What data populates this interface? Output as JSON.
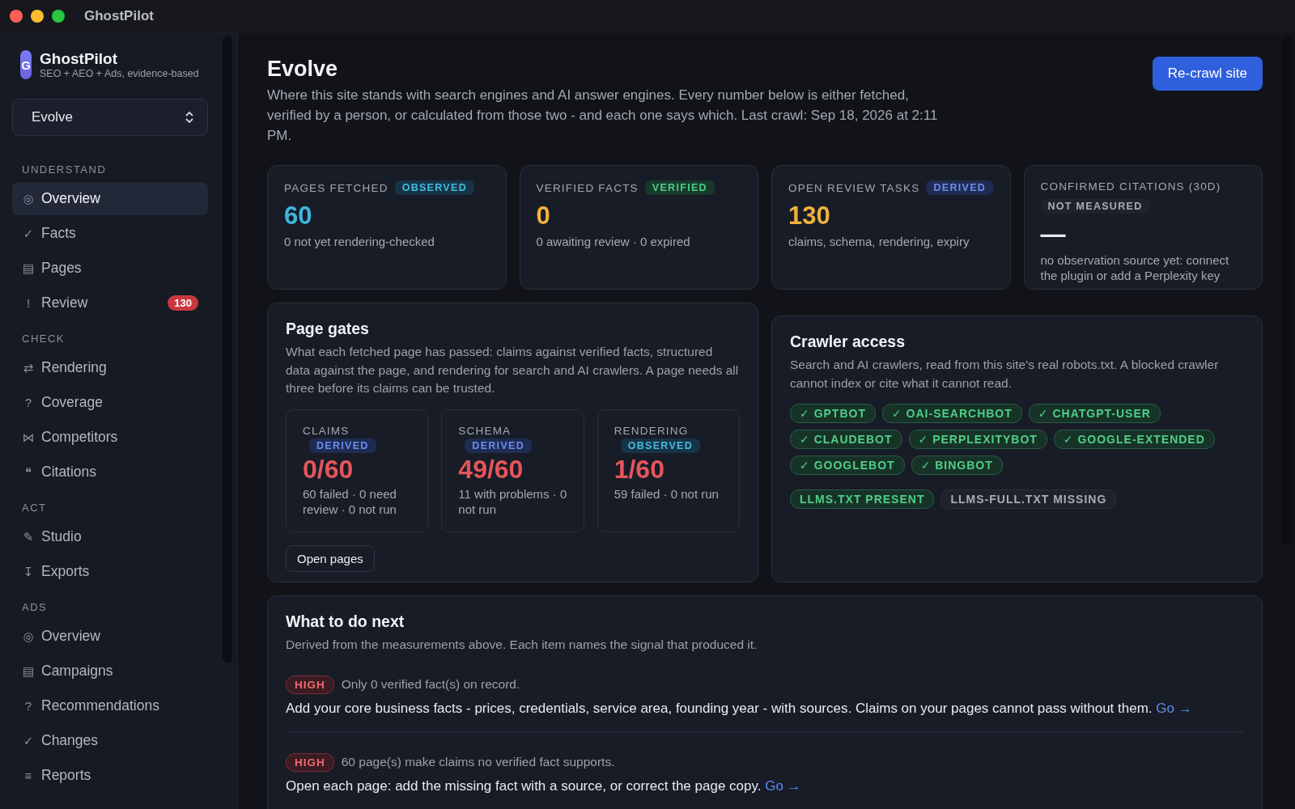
{
  "window": {
    "title": "GhostPilot"
  },
  "sidebar": {
    "brand": {
      "letter": "G",
      "name": "GhostPilot",
      "tagline": "SEO + AEO + Ads, evidence-based"
    },
    "site_select": {
      "value": "Evolve"
    },
    "sections": [
      {
        "heading": "UNDERSTAND",
        "items": [
          {
            "icon": "◎",
            "label": "Overview",
            "selected": true
          },
          {
            "icon": "✓",
            "label": "Facts",
            "selected": false
          },
          {
            "icon": "▤",
            "label": "Pages",
            "selected": false
          },
          {
            "icon": "!",
            "label": "Review",
            "selected": false,
            "count": "130"
          }
        ]
      },
      {
        "heading": "CHECK",
        "items": [
          {
            "icon": "⇄",
            "label": "Rendering",
            "selected": false
          },
          {
            "icon": "?",
            "label": "Coverage",
            "selected": false
          },
          {
            "icon": "⋈",
            "label": "Competitors",
            "selected": false
          },
          {
            "icon": "❝",
            "label": "Citations",
            "selected": false
          }
        ]
      },
      {
        "heading": "ACT",
        "items": [
          {
            "icon": "✎",
            "label": "Studio",
            "selected": false
          },
          {
            "icon": "↧",
            "label": "Exports",
            "selected": false
          }
        ]
      },
      {
        "heading": "ADS",
        "items": [
          {
            "icon": "◎",
            "label": "Overview",
            "selected": false
          },
          {
            "icon": "▤",
            "label": "Campaigns",
            "selected": false
          },
          {
            "icon": "?",
            "label": "Recommendations",
            "selected": false
          },
          {
            "icon": "✓",
            "label": "Changes",
            "selected": false
          },
          {
            "icon": "≡",
            "label": "Reports",
            "selected": false
          }
        ]
      }
    ]
  },
  "header": {
    "title": "Evolve",
    "description": "Where this site stands with search engines and AI answer engines. Every number below is either fetched, verified by a person, or calculated from those two - and each one says which. Last crawl: Sep 18, 2026 at 2:11 PM.",
    "button": "Re-crawl site"
  },
  "stats": [
    {
      "label": "PAGES FETCHED",
      "tag": {
        "kind": "observed",
        "text": "OBSERVED"
      },
      "value": "60",
      "color": "#3fb6dc",
      "note": "0 not yet rendering-checked"
    },
    {
      "label": "VERIFIED FACTS",
      "tag": {
        "kind": "verified",
        "text": "VERIFIED"
      },
      "value": "0",
      "color": "#f0b13c",
      "note": "0 awaiting review · 0 expired"
    },
    {
      "label": "OPEN REVIEW TASKS",
      "tag": {
        "kind": "derived",
        "text": "DERIVED"
      },
      "value": "130",
      "color": "#f0b13c",
      "note": "claims, schema, rendering, expiry"
    },
    {
      "label": "CONFIRMED CITATIONS (30D)",
      "tag": {
        "kind": "not_measured",
        "text": "NOT MEASURED"
      },
      "value": "—",
      "color": "#e8eaf0",
      "note": "no observation source yet: connect the plugin or add a Perplexity key"
    }
  ],
  "page_gates": {
    "title": "Page gates",
    "description": "What each fetched page has passed: claims against verified facts, structured data against the page, and rendering for search and AI crawlers. A page needs all three before its claims can be trusted.",
    "gates": [
      {
        "label": "CLAIMS",
        "tag": {
          "kind": "derived",
          "text": "DERIVED"
        },
        "value": "0/60",
        "note": "60 failed · 0 need review · 0 not run"
      },
      {
        "label": "SCHEMA",
        "tag": {
          "kind": "derived",
          "text": "DERIVED"
        },
        "value": "49/60",
        "note": "11 with problems · 0 not run"
      },
      {
        "label": "RENDERING",
        "tag": {
          "kind": "observed",
          "text": "OBSERVED"
        },
        "value": "1/60",
        "note": "59 failed · 0 not run"
      }
    ],
    "button": "Open pages"
  },
  "crawler_access": {
    "title": "Crawler access",
    "description": "Search and AI crawlers, read from this site's real robots.txt. A blocked crawler cannot index or cite what it cannot read.",
    "crawlers": [
      {
        "mark": "✓",
        "name": "GPTBOT",
        "allowed": true
      },
      {
        "mark": "✓",
        "name": "OAI-SEARCHBOT",
        "allowed": true
      },
      {
        "mark": "✓",
        "name": "CHATGPT-USER",
        "allowed": true
      },
      {
        "mark": "✓",
        "name": "CLAUDEBOT",
        "allowed": true
      },
      {
        "mark": "✓",
        "name": "PERPLEXITYBOT",
        "allowed": true
      },
      {
        "mark": "✓",
        "name": "GOOGLE-EXTENDED",
        "allowed": true
      },
      {
        "mark": "✓",
        "name": "GOOGLEBOT",
        "allowed": true
      },
      {
        "mark": "✓",
        "name": "BINGBOT",
        "allowed": true
      }
    ],
    "files": [
      {
        "label": "LLMS.TXT PRESENT",
        "present": true
      },
      {
        "label": "LLMS-FULL.TXT MISSING",
        "present": false
      }
    ]
  },
  "next_steps": {
    "title": "What to do next",
    "description": "Derived from the measurements above. Each item names the signal that produced it.",
    "items": [
      {
        "priority": {
          "kind": "high",
          "text": "HIGH"
        },
        "signal": "Only 0 verified fact(s) on record.",
        "action": "Add your core business facts - prices, credentials, service area, founding year - with sources. Claims on your pages cannot pass without them.",
        "link": "Go →"
      },
      {
        "priority": {
          "kind": "high",
          "text": "HIGH"
        },
        "signal": "60 page(s) make claims no verified fact supports.",
        "action": "Open each page: add the missing fact with a source, or correct the page copy.",
        "link": "Go →"
      }
    ]
  }
}
